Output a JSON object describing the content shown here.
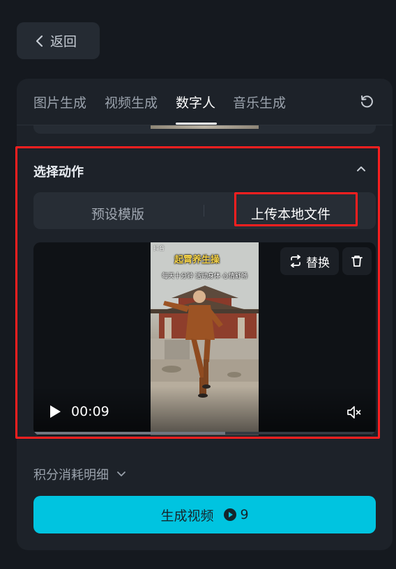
{
  "back_button": {
    "label": "返回",
    "icon": "chevron-left-icon"
  },
  "tabs": [
    {
      "label": "图片生成",
      "active": false
    },
    {
      "label": "视频生成",
      "active": false
    },
    {
      "label": "数字人",
      "active": true
    },
    {
      "label": "音乐生成",
      "active": false
    }
  ],
  "refresh_icon": "refresh-icon",
  "action_section": {
    "title": "选择动作",
    "collapse_icon": "chevron-up-icon",
    "segment": {
      "preset_label": "预设模版",
      "upload_label": "上传本地文件",
      "selected": "upload"
    }
  },
  "video": {
    "logo_text": "抖音",
    "overlay_title": "起霄养生操",
    "overlay_subtitle": "每天十分钟 活动身体 心情舒畅",
    "replace_label": "替换",
    "replace_icon": "swap-icon",
    "delete_icon": "trash-icon",
    "time": "00:09",
    "progress": 0.56,
    "muted": true
  },
  "points": {
    "label": "积分消耗明细",
    "icon": "chevron-down-icon"
  },
  "generate": {
    "label": "生成视频",
    "cost": "9",
    "cost_icon": "play-coin-icon"
  },
  "colors": {
    "accent": "#00c4e0",
    "highlight": "#ff1f1f",
    "panel": "#1d2229",
    "background": "#15191f"
  }
}
